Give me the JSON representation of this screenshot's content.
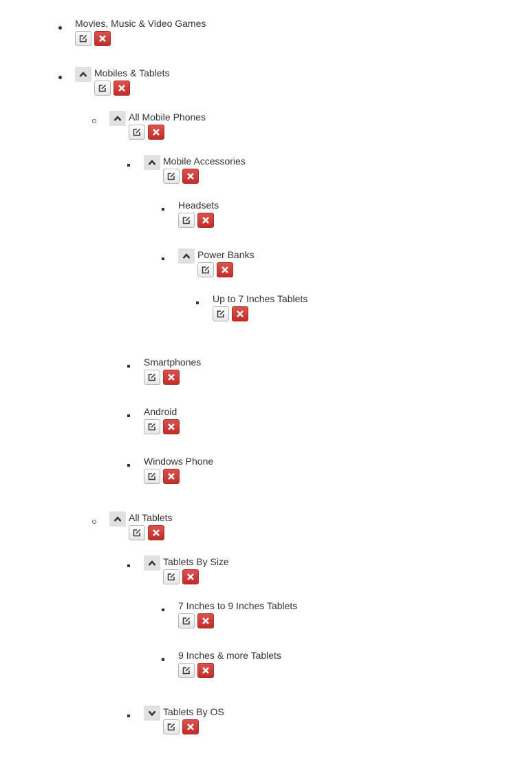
{
  "icons": {
    "collapse": "chevron-up-icon",
    "expand": "chevron-down-icon",
    "edit": "edit-icon",
    "delete": "delete-icon"
  },
  "colors": {
    "delete_button": "#d2322d",
    "toggle_button": "#e1e1e1",
    "text": "#333333"
  },
  "tree": [
    {
      "id": "movies",
      "label": "Movies, Music & Video Games",
      "toggle": "none"
    },
    {
      "id": "mobiles-tablets",
      "label": "Mobiles & Tablets",
      "toggle": "collapse"
    },
    {
      "id": "all-mobile-phones",
      "label": "All Mobile Phones",
      "toggle": "collapse"
    },
    {
      "id": "mobile-accessories",
      "label": "Mobile Accessories",
      "toggle": "collapse"
    },
    {
      "id": "headsets",
      "label": "Headsets",
      "toggle": "none"
    },
    {
      "id": "power-banks",
      "label": "Power Banks",
      "toggle": "collapse"
    },
    {
      "id": "up-to-7",
      "label": "Up to 7 Inches Tablets",
      "toggle": "none"
    },
    {
      "id": "smartphones",
      "label": "Smartphones",
      "toggle": "none"
    },
    {
      "id": "android",
      "label": "Android",
      "toggle": "none"
    },
    {
      "id": "windows-phone",
      "label": "Windows Phone",
      "toggle": "none"
    },
    {
      "id": "all-tablets",
      "label": "All Tablets",
      "toggle": "collapse"
    },
    {
      "id": "tablets-by-size",
      "label": "Tablets By Size",
      "toggle": "collapse"
    },
    {
      "id": "7-to-9",
      "label": "7 Inches to 9 Inches Tablets",
      "toggle": "none"
    },
    {
      "id": "9-and-more",
      "label": "9 Inches & more Tablets",
      "toggle": "none"
    },
    {
      "id": "tablets-by-os",
      "label": "Tablets By OS",
      "toggle": "expand"
    }
  ]
}
